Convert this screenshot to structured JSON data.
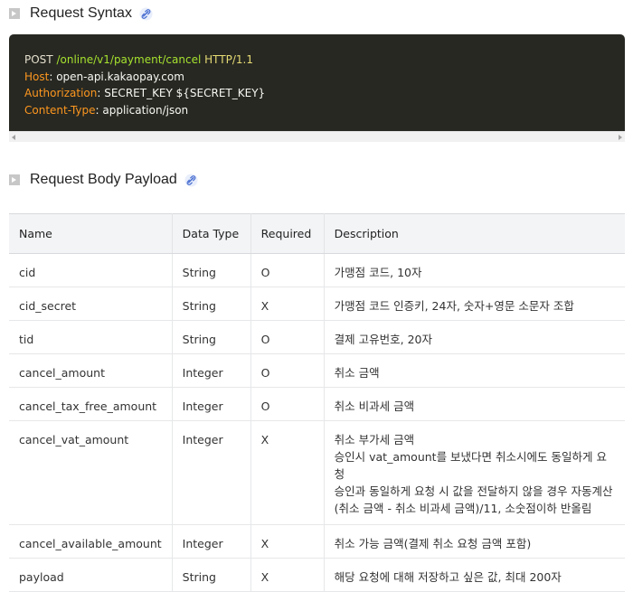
{
  "section_syntax": {
    "title": "Request Syntax"
  },
  "code": {
    "method": "POST",
    "path": "/online/v1/payment/cancel",
    "protocol": "HTTP/1.1",
    "headers": [
      {
        "name": "Host",
        "value": "open-api.kakaopay.com"
      },
      {
        "name": "Authorization",
        "value": "SECRET_KEY ${SECRET_KEY}"
      },
      {
        "name": "Content-Type",
        "value": "application/json"
      }
    ]
  },
  "section_payload": {
    "title": "Request Body Payload"
  },
  "table": {
    "headers": [
      "Name",
      "Data Type",
      "Required",
      "Description"
    ],
    "rows": [
      {
        "name": "cid",
        "type": "String",
        "required": "O",
        "description": [
          "가맹점 코드, 10자"
        ]
      },
      {
        "name": "cid_secret",
        "type": "String",
        "required": "X",
        "description": [
          "가맹점 코드 인증키, 24자, 숫자+영문 소문자 조합"
        ]
      },
      {
        "name": "tid",
        "type": "String",
        "required": "O",
        "description": [
          "결제 고유번호, 20자"
        ]
      },
      {
        "name": "cancel_amount",
        "type": "Integer",
        "required": "O",
        "description": [
          "취소 금액"
        ]
      },
      {
        "name": "cancel_tax_free_amount",
        "type": "Integer",
        "required": "O",
        "description": [
          "취소 비과세 금액"
        ]
      },
      {
        "name": "cancel_vat_amount",
        "type": "Integer",
        "required": "X",
        "description": [
          "취소 부가세 금액",
          "승인시 vat_amount를 보냈다면 취소시에도 동일하게 요청",
          "승인과 동일하게 요청 시 값을 전달하지 않을 경우 자동계산",
          "(취소 금액 - 취소 비과세 금액)/11, 소숫점이하 반올림"
        ]
      },
      {
        "name": "cancel_available_amount",
        "type": "Integer",
        "required": "X",
        "description": [
          "취소 가능 금액(결제 취소 요청 금액 포함)"
        ]
      },
      {
        "name": "payload",
        "type": "String",
        "required": "X",
        "description": [
          "해당 요청에 대해 저장하고 싶은 값, 최대 200자"
        ]
      }
    ]
  }
}
